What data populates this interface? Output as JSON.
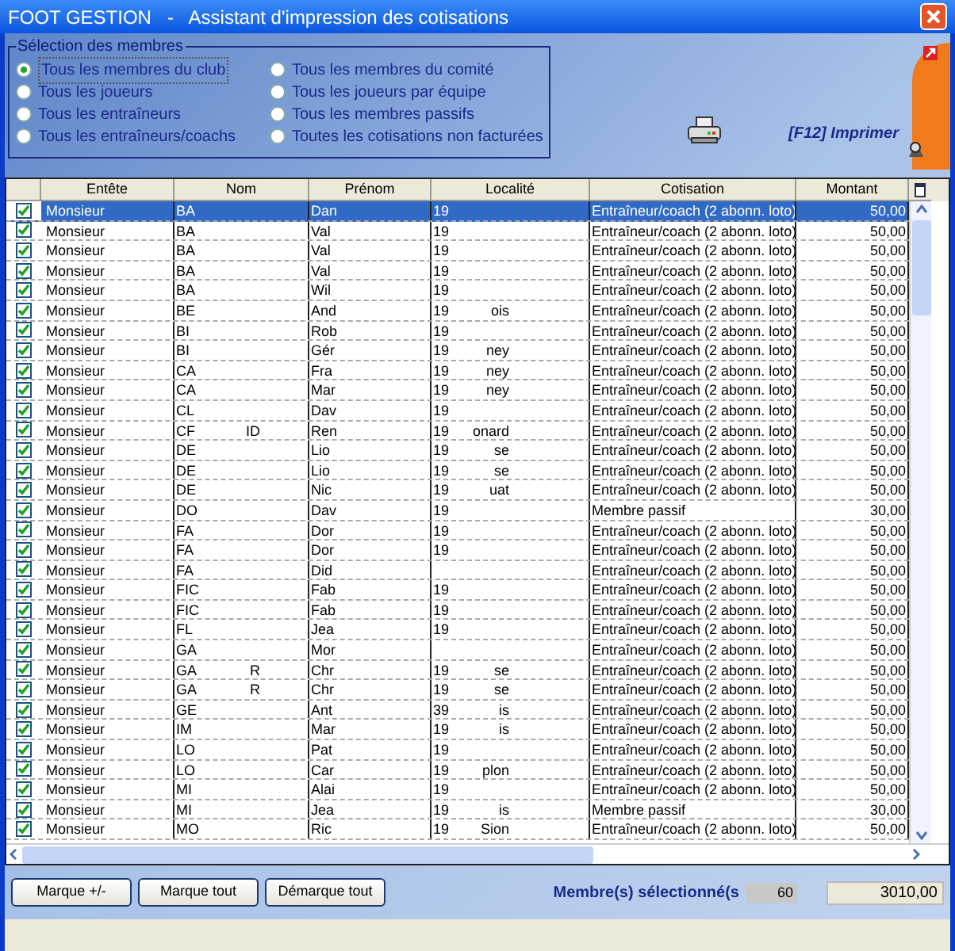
{
  "window": {
    "title": "FOOT GESTION   -   Assistant d'impression des cotisations"
  },
  "selection": {
    "title": "Sélection des membres",
    "options": [
      {
        "label": "Tous les membres du club",
        "selected": true
      },
      {
        "label": "Tous les joueurs",
        "selected": false
      },
      {
        "label": "Tous les entraîneurs",
        "selected": false
      },
      {
        "label": "Tous les entraîneurs/coachs",
        "selected": false
      },
      {
        "label": "Tous les membres du comité",
        "selected": false
      },
      {
        "label": "Tous les joueurs par équipe",
        "selected": false
      },
      {
        "label": "Tous les membres passifs",
        "selected": false
      },
      {
        "label": "Toutes les cotisations non facturées",
        "selected": false
      }
    ]
  },
  "print": {
    "label": "[F12] Imprimer"
  },
  "table": {
    "columns": [
      "Entête",
      "Nom",
      "Prénom",
      "Localité",
      "Cotisation",
      "Montant"
    ],
    "rows": [
      {
        "checked": true,
        "selected": true,
        "entete": "Monsieur",
        "nom": "BA",
        "prenom": "Dan",
        "localite": "19",
        "localite_end": "",
        "cotisation": "Entraîneur/coach (2 abonn. loto)",
        "montant": "50,00"
      },
      {
        "checked": true,
        "selected": false,
        "entete": "Monsieur",
        "nom": "BA",
        "prenom": "Val",
        "localite": "19",
        "localite_end": "",
        "cotisation": "Entraîneur/coach (2 abonn. loto)",
        "montant": "50,00"
      },
      {
        "checked": true,
        "selected": false,
        "entete": "Monsieur",
        "nom": "BA",
        "prenom": "Val",
        "localite": "19",
        "localite_end": "",
        "cotisation": "Entraîneur/coach (2 abonn. loto)",
        "montant": "50,00"
      },
      {
        "checked": true,
        "selected": false,
        "entete": "Monsieur",
        "nom": "BA",
        "prenom": "Val",
        "localite": "19",
        "localite_end": "",
        "cotisation": "Entraîneur/coach (2 abonn. loto)",
        "montant": "50,00"
      },
      {
        "checked": true,
        "selected": false,
        "entete": "Monsieur",
        "nom": "BA",
        "prenom": "Wil",
        "localite": "19",
        "localite_end": "",
        "cotisation": "Entraîneur/coach (2 abonn. loto)",
        "montant": "50,00"
      },
      {
        "checked": true,
        "selected": false,
        "entete": "Monsieur",
        "nom": "BE",
        "prenom": "And",
        "localite": "19",
        "localite_end": "ois",
        "cotisation": "Entraîneur/coach (2 abonn. loto)",
        "montant": "50,00"
      },
      {
        "checked": true,
        "selected": false,
        "entete": "Monsieur",
        "nom": "BI",
        "prenom": "Rob",
        "localite": "19",
        "localite_end": "",
        "cotisation": "Entraîneur/coach (2 abonn. loto)",
        "montant": "50,00"
      },
      {
        "checked": true,
        "selected": false,
        "entete": "Monsieur",
        "nom": "BI",
        "prenom": "Gér",
        "localite": "19",
        "localite_end": "ney",
        "cotisation": "Entraîneur/coach (2 abonn. loto)",
        "montant": "50,00"
      },
      {
        "checked": true,
        "selected": false,
        "entete": "Monsieur",
        "nom": "CA",
        "prenom": "Fra",
        "localite": "19",
        "localite_end": "ney",
        "cotisation": "Entraîneur/coach (2 abonn. loto)",
        "montant": "50,00"
      },
      {
        "checked": true,
        "selected": false,
        "entete": "Monsieur",
        "nom": "CA",
        "prenom": "Mar",
        "localite": "19",
        "localite_end": "ney",
        "cotisation": "Entraîneur/coach (2 abonn. loto)",
        "montant": "50,00"
      },
      {
        "checked": true,
        "selected": false,
        "entete": "Monsieur",
        "nom": "CL",
        "prenom": "Dav",
        "localite": "19",
        "localite_end": "",
        "cotisation": "Entraîneur/coach (2 abonn. loto)",
        "montant": "50,00"
      },
      {
        "checked": true,
        "selected": false,
        "entete": "Monsieur",
        "nom": "CF",
        "nom_end": "ID",
        "prenom": "Ren",
        "localite": "19",
        "localite_end": "onard",
        "cotisation": "Entraîneur/coach (2 abonn. loto)",
        "montant": "50,00"
      },
      {
        "checked": true,
        "selected": false,
        "entete": "Monsieur",
        "nom": "DE",
        "prenom": "Lio",
        "localite": "19",
        "localite_end": "se",
        "cotisation": "Entraîneur/coach (2 abonn. loto)",
        "montant": "50,00"
      },
      {
        "checked": true,
        "selected": false,
        "entete": "Monsieur",
        "nom": "DE",
        "prenom": "Lio",
        "localite": "19",
        "localite_end": "se",
        "cotisation": "Entraîneur/coach (2 abonn. loto)",
        "montant": "50,00"
      },
      {
        "checked": true,
        "selected": false,
        "entete": "Monsieur",
        "nom": "DE",
        "prenom": "Nic",
        "localite": "19",
        "localite_end": "uat",
        "cotisation": "Entraîneur/coach (2 abonn. loto)",
        "montant": "50,00"
      },
      {
        "checked": true,
        "selected": false,
        "entete": "Monsieur",
        "nom": "DO",
        "prenom": "Dav",
        "localite": "19",
        "localite_end": "",
        "cotisation": "Membre passif",
        "montant": "30,00"
      },
      {
        "checked": true,
        "selected": false,
        "entete": "Monsieur",
        "nom": "FA",
        "prenom": "Dor",
        "localite": "19",
        "localite_end": "",
        "cotisation": "Entraîneur/coach (2 abonn. loto)",
        "montant": "50,00"
      },
      {
        "checked": true,
        "selected": false,
        "entete": "Monsieur",
        "nom": "FA",
        "prenom": "Dor",
        "localite": "19",
        "localite_end": "",
        "cotisation": "Entraîneur/coach (2 abonn. loto)",
        "montant": "50,00"
      },
      {
        "checked": true,
        "selected": false,
        "entete": "Monsieur",
        "nom": "FA",
        "prenom": "Did",
        "localite": "",
        "localite_end": "",
        "cotisation": "Entraîneur/coach (2 abonn. loto)",
        "montant": "50,00"
      },
      {
        "checked": true,
        "selected": false,
        "entete": "Monsieur",
        "nom": "FIC",
        "prenom": "Fab",
        "localite": "19",
        "localite_end": "",
        "cotisation": "Entraîneur/coach (2 abonn. loto)",
        "montant": "50,00"
      },
      {
        "checked": true,
        "selected": false,
        "entete": "Monsieur",
        "nom": "FIC",
        "prenom": "Fab",
        "localite": "19",
        "localite_end": "",
        "cotisation": "Entraîneur/coach (2 abonn. loto)",
        "montant": "50,00"
      },
      {
        "checked": true,
        "selected": false,
        "entete": "Monsieur",
        "nom": "FL",
        "prenom": "Jea",
        "localite": "19",
        "localite_end": "",
        "cotisation": "Entraîneur/coach (2 abonn. loto)",
        "montant": "50,00"
      },
      {
        "checked": true,
        "selected": false,
        "entete": "Monsieur",
        "nom": "GA",
        "prenom": "Mor",
        "localite": "",
        "localite_end": "",
        "cotisation": "Entraîneur/coach (2 abonn. loto)",
        "montant": "50,00"
      },
      {
        "checked": true,
        "selected": false,
        "entete": "Monsieur",
        "nom": "GA",
        "nom_end": "R",
        "prenom": "Chr",
        "localite": "19",
        "localite_end": "se",
        "cotisation": "Entraîneur/coach (2 abonn. loto)",
        "montant": "50,00"
      },
      {
        "checked": true,
        "selected": false,
        "entete": "Monsieur",
        "nom": "GA",
        "nom_end": "R",
        "prenom": "Chr",
        "localite": "19",
        "localite_end": "se",
        "cotisation": "Entraîneur/coach (2 abonn. loto)",
        "montant": "50,00"
      },
      {
        "checked": true,
        "selected": false,
        "entete": "Monsieur",
        "nom": "GE",
        "prenom": "Ant",
        "localite": "39",
        "localite_end": "is",
        "cotisation": "Entraîneur/coach (2 abonn. loto)",
        "montant": "50,00"
      },
      {
        "checked": true,
        "selected": false,
        "entete": "Monsieur",
        "nom": "IM",
        "prenom": "Mar",
        "localite": "19",
        "localite_end": "is",
        "cotisation": "Entraîneur/coach (2 abonn. loto)",
        "montant": "50,00"
      },
      {
        "checked": true,
        "selected": false,
        "entete": "Monsieur",
        "nom": "LO",
        "prenom": "Pat",
        "localite": "19",
        "localite_end": "",
        "cotisation": "Entraîneur/coach (2 abonn. loto)",
        "montant": "50,00"
      },
      {
        "checked": true,
        "selected": false,
        "entete": "Monsieur",
        "nom": "LO",
        "prenom": "Car",
        "localite": "19",
        "localite_end": "plon",
        "cotisation": "Entraîneur/coach (2 abonn. loto)",
        "montant": "50,00"
      },
      {
        "checked": true,
        "selected": false,
        "entete": "Monsieur",
        "nom": "MI",
        "prenom": "Alai",
        "localite": "19",
        "localite_end": "",
        "cotisation": "Entraîneur/coach (2 abonn. loto)",
        "montant": "50,00"
      },
      {
        "checked": true,
        "selected": false,
        "entete": "Monsieur",
        "nom": "MI",
        "prenom": "Jea",
        "localite": "19",
        "localite_end": "is",
        "cotisation": "Membre passif",
        "montant": "30,00"
      },
      {
        "checked": true,
        "selected": false,
        "entete": "Monsieur",
        "nom": "MO",
        "prenom": "Ric",
        "localite": "19",
        "localite_end": "Sion",
        "cotisation": "Entraîneur/coach (2 abonn. loto)",
        "montant": "50,00"
      }
    ]
  },
  "buttons": [
    "Marque +/-",
    "Marque tout",
    "Démarque tout"
  ],
  "footer": {
    "label": "Membre(s) sélectionné(s",
    "count": "60",
    "total": "3010,00"
  }
}
